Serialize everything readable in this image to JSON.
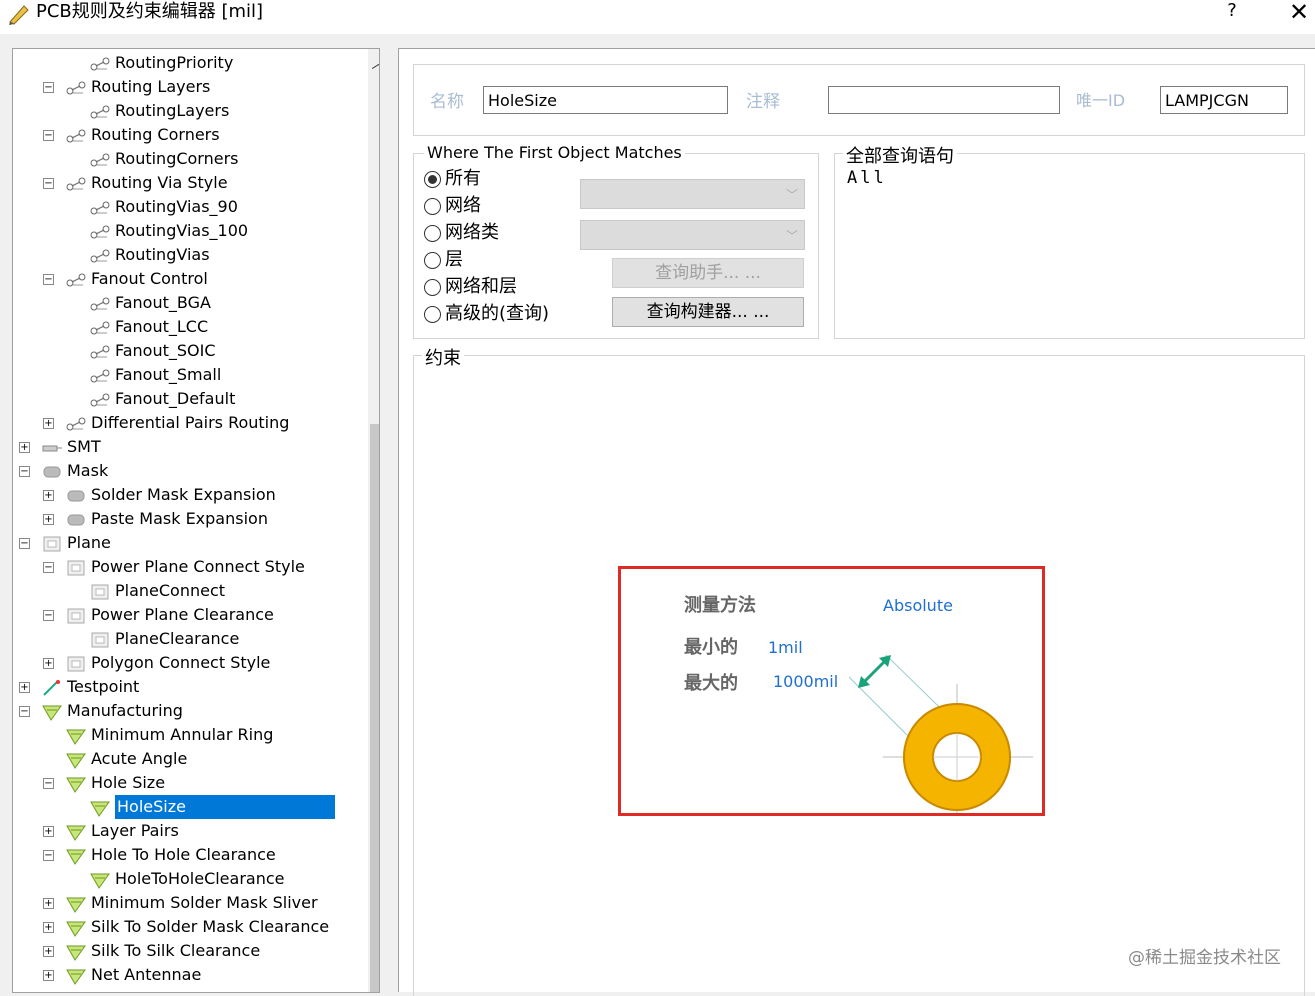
{
  "window": {
    "title": "PCB规则及约束编辑器 [mil]",
    "help": "?",
    "close": "✕"
  },
  "tree": {
    "nodes": [
      {
        "label": "RoutingPriority",
        "level": 3,
        "toggle": "",
        "icon": "rule"
      },
      {
        "label": "Routing Layers",
        "level": 2,
        "toggle": "−",
        "icon": "rule"
      },
      {
        "label": "RoutingLayers",
        "level": 3,
        "toggle": "",
        "icon": "rule"
      },
      {
        "label": "Routing Corners",
        "level": 2,
        "toggle": "−",
        "icon": "rule"
      },
      {
        "label": "RoutingCorners",
        "level": 3,
        "toggle": "",
        "icon": "rule"
      },
      {
        "label": "Routing Via Style",
        "level": 2,
        "toggle": "−",
        "icon": "rule"
      },
      {
        "label": "RoutingVias_90",
        "level": 3,
        "toggle": "",
        "icon": "rule"
      },
      {
        "label": "RoutingVias_100",
        "level": 3,
        "toggle": "",
        "icon": "rule"
      },
      {
        "label": "RoutingVias",
        "level": 3,
        "toggle": "",
        "icon": "rule"
      },
      {
        "label": "Fanout Control",
        "level": 2,
        "toggle": "−",
        "icon": "rule"
      },
      {
        "label": "Fanout_BGA",
        "level": 3,
        "toggle": "",
        "icon": "rule"
      },
      {
        "label": "Fanout_LCC",
        "level": 3,
        "toggle": "",
        "icon": "rule"
      },
      {
        "label": "Fanout_SOIC",
        "level": 3,
        "toggle": "",
        "icon": "rule"
      },
      {
        "label": "Fanout_Small",
        "level": 3,
        "toggle": "",
        "icon": "rule"
      },
      {
        "label": "Fanout_Default",
        "level": 3,
        "toggle": "",
        "icon": "rule"
      },
      {
        "label": "Differential Pairs Routing",
        "level": 2,
        "toggle": "+",
        "icon": "rule"
      },
      {
        "label": "SMT",
        "level": 1,
        "toggle": "+",
        "icon": "smt"
      },
      {
        "label": "Mask",
        "level": 1,
        "toggle": "−",
        "icon": "mask"
      },
      {
        "label": "Solder Mask Expansion",
        "level": 2,
        "toggle": "+",
        "icon": "mask"
      },
      {
        "label": "Paste Mask Expansion",
        "level": 2,
        "toggle": "+",
        "icon": "mask"
      },
      {
        "label": "Plane",
        "level": 1,
        "toggle": "−",
        "icon": "plane"
      },
      {
        "label": "Power Plane Connect Style",
        "level": 2,
        "toggle": "−",
        "icon": "plane"
      },
      {
        "label": "PlaneConnect",
        "level": 3,
        "toggle": "",
        "icon": "plane"
      },
      {
        "label": "Power Plane Clearance",
        "level": 2,
        "toggle": "−",
        "icon": "plane"
      },
      {
        "label": "PlaneClearance",
        "level": 3,
        "toggle": "",
        "icon": "plane"
      },
      {
        "label": "Polygon Connect Style",
        "level": 2,
        "toggle": "+",
        "icon": "plane"
      },
      {
        "label": "Testpoint",
        "level": 1,
        "toggle": "+",
        "icon": "testpoint"
      },
      {
        "label": "Manufacturing",
        "level": 1,
        "toggle": "−",
        "icon": "mfg"
      },
      {
        "label": "Minimum Annular Ring",
        "level": 2,
        "toggle": "",
        "icon": "mfg"
      },
      {
        "label": "Acute Angle",
        "level": 2,
        "toggle": "",
        "icon": "mfg"
      },
      {
        "label": "Hole Size",
        "level": 2,
        "toggle": "−",
        "icon": "mfg"
      },
      {
        "label": "HoleSize",
        "level": 3,
        "toggle": "",
        "icon": "mfg",
        "selected": true
      },
      {
        "label": "Layer Pairs",
        "level": 2,
        "toggle": "+",
        "icon": "mfg"
      },
      {
        "label": "Hole To Hole Clearance",
        "level": 2,
        "toggle": "−",
        "icon": "mfg"
      },
      {
        "label": "HoleToHoleClearance",
        "level": 3,
        "toggle": "",
        "icon": "mfg"
      },
      {
        "label": "Minimum Solder Mask Sliver",
        "level": 2,
        "toggle": "+",
        "icon": "mfg"
      },
      {
        "label": "Silk To Solder Mask Clearance",
        "level": 2,
        "toggle": "+",
        "icon": "mfg"
      },
      {
        "label": "Silk To Silk Clearance",
        "level": 2,
        "toggle": "+",
        "icon": "mfg"
      },
      {
        "label": "Net Antennae",
        "level": 2,
        "toggle": "+",
        "icon": "mfg"
      }
    ]
  },
  "header": {
    "name_label": "名称",
    "name_value": "HoleSize",
    "comment_label": "注释",
    "comment_value": "",
    "id_label": "唯一ID",
    "id_value": "LAMPJCGN"
  },
  "match": {
    "title": "Where The First Object Matches",
    "options": [
      "所有",
      "网络",
      "网络类",
      "层",
      "网络和层",
      "高级的(查询)"
    ],
    "selected_index": 0,
    "query_helper": "查询助手... ...",
    "query_builder": "查询构建器... ..."
  },
  "query": {
    "title": "全部查询语句",
    "text": "All"
  },
  "constraint": {
    "title": "约束",
    "measure_label": "测量方法",
    "measure_value": "Absolute",
    "min_label": "最小的",
    "min_value": "1mil",
    "max_label": "最大的",
    "max_value": "1000mil"
  },
  "watermark": "@稀土掘金技术社区",
  "colors": {
    "selection": "#0078d7",
    "highlight_box": "#e02a24",
    "value_text": "#1f6fd1",
    "ring_fill": "#f5b400",
    "arrow": "#1aa37a"
  }
}
